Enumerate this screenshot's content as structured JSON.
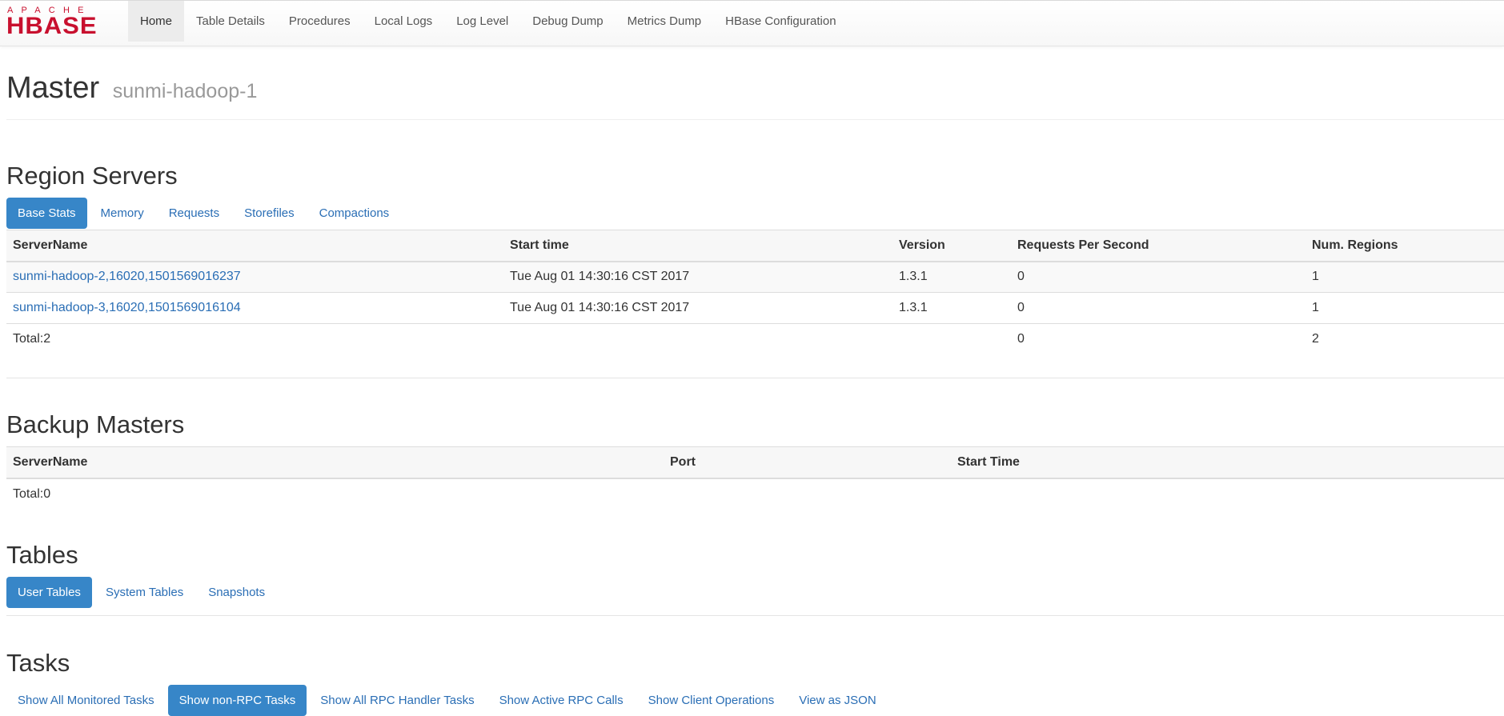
{
  "navbar": {
    "logo_top": "APACHE",
    "logo_main": "HBASE",
    "items": [
      {
        "label": "Home"
      },
      {
        "label": "Table Details"
      },
      {
        "label": "Procedures"
      },
      {
        "label": "Local Logs"
      },
      {
        "label": "Log Level"
      },
      {
        "label": "Debug Dump"
      },
      {
        "label": "Metrics Dump"
      },
      {
        "label": "HBase Configuration"
      }
    ],
    "active_index": 0
  },
  "header": {
    "title": "Master",
    "subtitle": "sunmi-hadoop-1"
  },
  "region_servers": {
    "title": "Region Servers",
    "tabs": [
      {
        "label": "Base Stats"
      },
      {
        "label": "Memory"
      },
      {
        "label": "Requests"
      },
      {
        "label": "Storefiles"
      },
      {
        "label": "Compactions"
      }
    ],
    "active_tab": 0,
    "columns": [
      "ServerName",
      "Start time",
      "Version",
      "Requests Per Second",
      "Num. Regions"
    ],
    "rows": [
      {
        "server": "sunmi-hadoop-2,16020,1501569016237",
        "start": "Tue Aug 01 14:30:16 CST 2017",
        "version": "1.3.1",
        "rps": "0",
        "regions": "1"
      },
      {
        "server": "sunmi-hadoop-3,16020,1501569016104",
        "start": "Tue Aug 01 14:30:16 CST 2017",
        "version": "1.3.1",
        "rps": "0",
        "regions": "1"
      }
    ],
    "total": {
      "label": "Total:2",
      "rps": "0",
      "regions": "2"
    }
  },
  "backup_masters": {
    "title": "Backup Masters",
    "columns": [
      "ServerName",
      "Port",
      "Start Time"
    ],
    "total": "Total:0"
  },
  "tables": {
    "title": "Tables",
    "tabs": [
      {
        "label": "User Tables"
      },
      {
        "label": "System Tables"
      },
      {
        "label": "Snapshots"
      }
    ],
    "active_tab": 0
  },
  "tasks": {
    "title": "Tasks",
    "buttons": [
      {
        "label": "Show All Monitored Tasks"
      },
      {
        "label": "Show non-RPC Tasks"
      },
      {
        "label": "Show All RPC Handler Tasks"
      },
      {
        "label": "Show Active RPC Calls"
      },
      {
        "label": "Show Client Operations"
      },
      {
        "label": "View as JSON"
      }
    ],
    "active_index": 1
  },
  "colors": {
    "brand": "#c8102e",
    "link": "#2a6eb5",
    "active_tab_bg": "#3786c8"
  }
}
